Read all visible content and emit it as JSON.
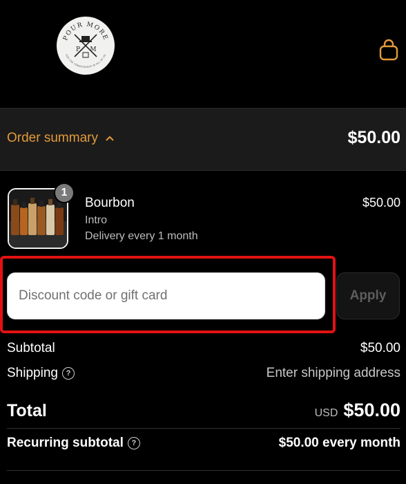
{
  "brand": {
    "logo_text": "POUR MORE",
    "logo_monogram_left": "P",
    "logo_monogram_right": "M",
    "logo_ring_text": "FOR THE CONNOISSEUR IN ALL OF US"
  },
  "header": {
    "cart_icon": "shopping-bag-icon"
  },
  "summary": {
    "toggle_label": "Order summary",
    "toggle_icon": "chevron-up-icon",
    "total": "$50.00"
  },
  "product": {
    "quantity": "1",
    "name": "Bourbon",
    "variant": "Intro",
    "delivery": "Delivery every 1 month",
    "price": "$50.00"
  },
  "discount": {
    "placeholder": "Discount code or gift card",
    "apply_label": "Apply"
  },
  "totals": {
    "subtotal_label": "Subtotal",
    "subtotal_value": "$50.00",
    "shipping_label": "Shipping",
    "shipping_value": "Enter shipping address",
    "total_label": "Total",
    "currency": "USD",
    "total_value": "$50.00",
    "recurring_label": "Recurring subtotal",
    "recurring_value": "$50.00 every month"
  },
  "colors": {
    "accent": "#e39a3b",
    "background": "#000000",
    "summary_bg": "#1b1b1b",
    "highlight_box": "#e31212"
  }
}
